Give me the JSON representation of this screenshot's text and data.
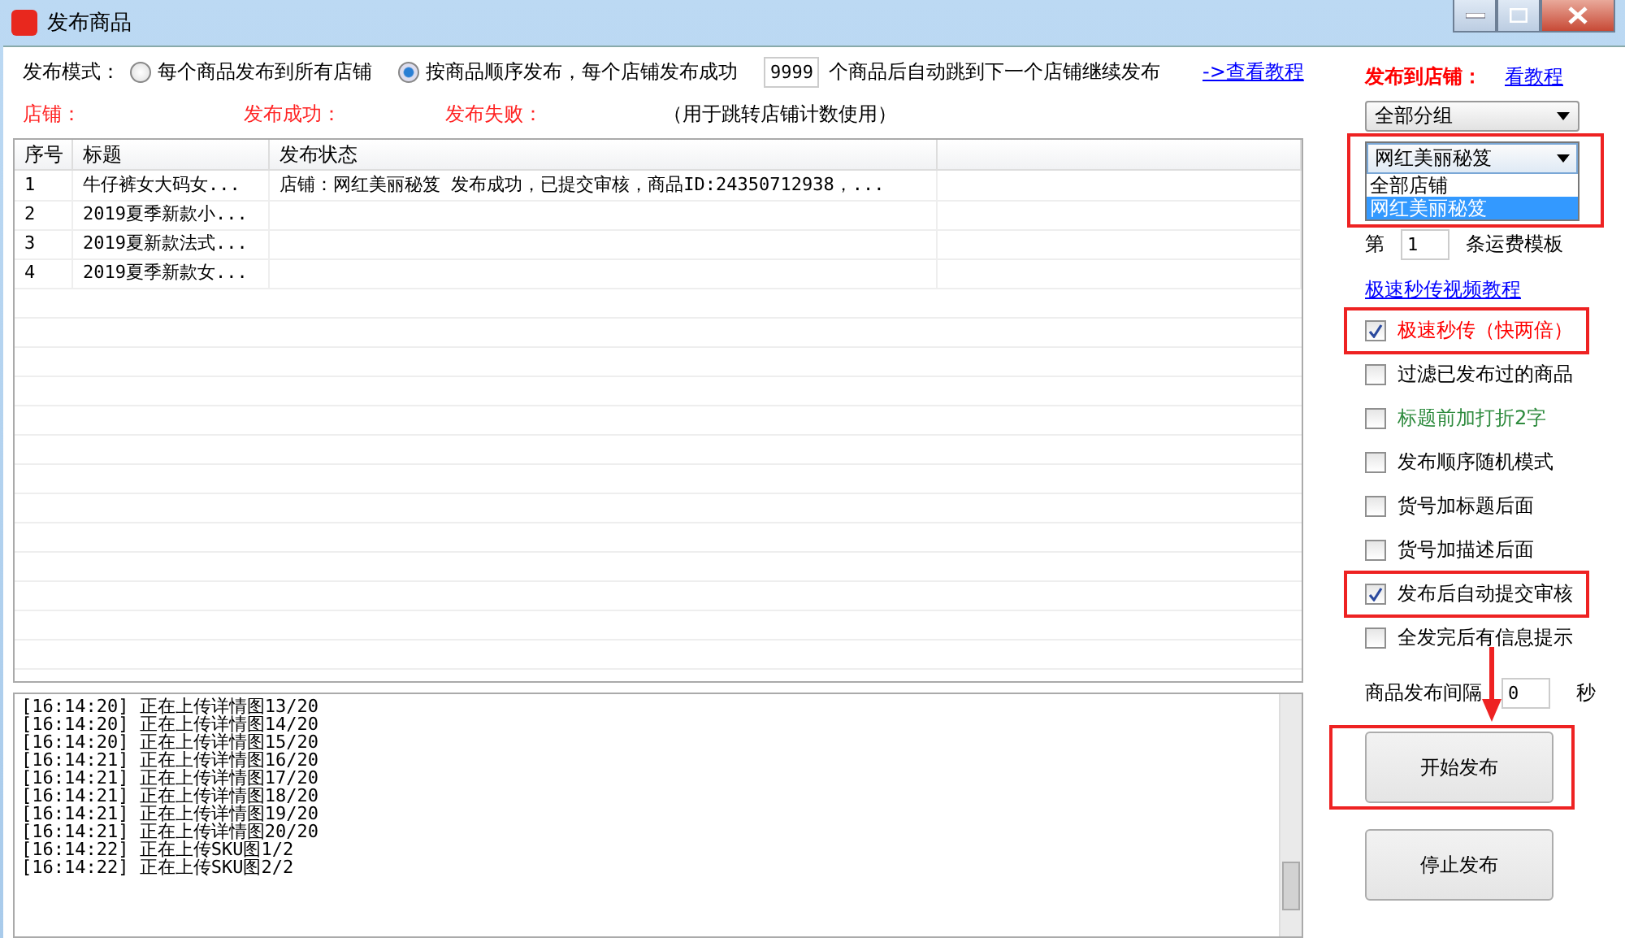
{
  "window": {
    "title": "发布商品"
  },
  "mode": {
    "label": "发布模式：",
    "options": [
      {
        "label": "每个商品发布到所有店铺",
        "selected": false
      },
      {
        "label": "按商品顺序发布，每个店铺发布成功",
        "selected": true
      }
    ],
    "count": "9999",
    "suffix": "个商品后自动跳到下一个店铺继续发布",
    "link": "->查看教程"
  },
  "status_labels": [
    "店铺：",
    "发布成功：",
    "发布失败："
  ],
  "note": "（用于跳转店铺计数使用）",
  "table": {
    "columns": [
      "序号",
      "标题",
      "发布状态"
    ],
    "rows": [
      {
        "cells": [
          "1",
          "牛仔裤女大码女...",
          "店铺：网红美丽秘笈 发布成功，已提交审核，商品ID:24350712938，..."
        ]
      },
      {
        "cells": [
          "2",
          "2019夏季新款小...",
          ""
        ]
      },
      {
        "cells": [
          "3",
          "2019夏新款法式...",
          ""
        ]
      },
      {
        "cells": [
          "4",
          "2019夏季新款女...",
          ""
        ]
      }
    ]
  },
  "log": [
    "[16:14:20] 正在上传详情图13/20",
    "[16:14:20] 正在上传详情图14/20",
    "[16:14:20] 正在上传详情图15/20",
    "[16:14:21] 正在上传详情图16/20",
    "[16:14:21] 正在上传详情图17/20",
    "[16:14:21] 正在上传详情图18/20",
    "[16:14:21] 正在上传详情图19/20",
    "[16:14:21] 正在上传详情图20/20",
    "[16:14:22] 正在上传SKU图1/2",
    "[16:14:22] 正在上传SKU图2/2"
  ],
  "sidebar": {
    "title": "发布到店铺：",
    "tutorial_link": "看教程",
    "group_select": "全部分组",
    "shop_select": {
      "annotated": true,
      "value": "网红美丽秘笈",
      "options": [
        {
          "label": "全部店铺",
          "selected": false
        },
        {
          "label": "网红美丽秘笈",
          "selected": true
        }
      ]
    },
    "template": {
      "prefix": "第",
      "value": "1",
      "suffix": "条运费模板"
    },
    "video_link": "极速秒传视频教程",
    "options": [
      {
        "label": "极速秒传（快两倍）",
        "checked": true,
        "color": "#ff0000",
        "annotated": true
      },
      {
        "label": "过滤已发布过的商品",
        "checked": false,
        "color": "#000000",
        "annotated": false
      },
      {
        "label": "标题前加打折2字",
        "checked": false,
        "color": "#2e8b3e",
        "annotated": false
      },
      {
        "label": "发布顺序随机模式",
        "checked": false,
        "color": "#000000",
        "annotated": false
      },
      {
        "label": "货号加标题后面",
        "checked": false,
        "color": "#000000",
        "annotated": false
      },
      {
        "label": "货号加描述后面",
        "checked": false,
        "color": "#000000",
        "annotated": false
      },
      {
        "label": "发布后自动提交审核",
        "checked": true,
        "color": "#000000",
        "annotated": true
      },
      {
        "label": "全发完后有信息提示",
        "checked": false,
        "color": "#000000",
        "annotated": false
      }
    ],
    "interval": {
      "label": "商品发布间隔",
      "value": "0",
      "unit": "秒"
    },
    "buttons": [
      {
        "label": "开始发布",
        "annotated": true
      },
      {
        "label": "停止发布",
        "annotated": false
      }
    ]
  }
}
